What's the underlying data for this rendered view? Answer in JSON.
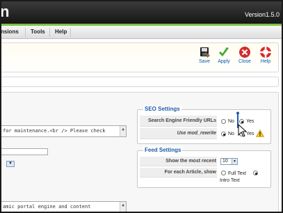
{
  "app": {
    "title_fragment": "n",
    "version": "Version1.5.0"
  },
  "menu": {
    "items": [
      "nsions",
      "Tools",
      "Help"
    ]
  },
  "toolbar": {
    "save_label": "Save",
    "apply_label": "Apply",
    "close_label": "Close",
    "help_label": "Help"
  },
  "content": {
    "offline_message_text": " for maintenance.<br /> Please check",
    "meta_description_text": "amic portal engine and content",
    "list_limit_select": "▼"
  },
  "seo_settings": {
    "legend": "SEO Settings",
    "sef_urls": {
      "label": "Search Engine Friendly URLs",
      "no": "No",
      "yes": "Yes",
      "selected": "Yes"
    },
    "mod_rewrite": {
      "label": "Use mod_rewrite",
      "no": "No",
      "yes": "Yes",
      "selected": "No",
      "warning": "warning-icon"
    }
  },
  "feed_settings": {
    "legend": "Feed Settings",
    "show_most_recent": {
      "label": "Show the most recent",
      "value": "10"
    },
    "for_each_article": {
      "label": "For each Article, show",
      "option_full": "Full Text",
      "option_intro": "Intro Text",
      "selected": "Intro Text"
    }
  },
  "colors": {
    "accent_green": "#7bc142",
    "link_blue": "#0a5aa8",
    "legend_blue": "#1e5aa8"
  }
}
